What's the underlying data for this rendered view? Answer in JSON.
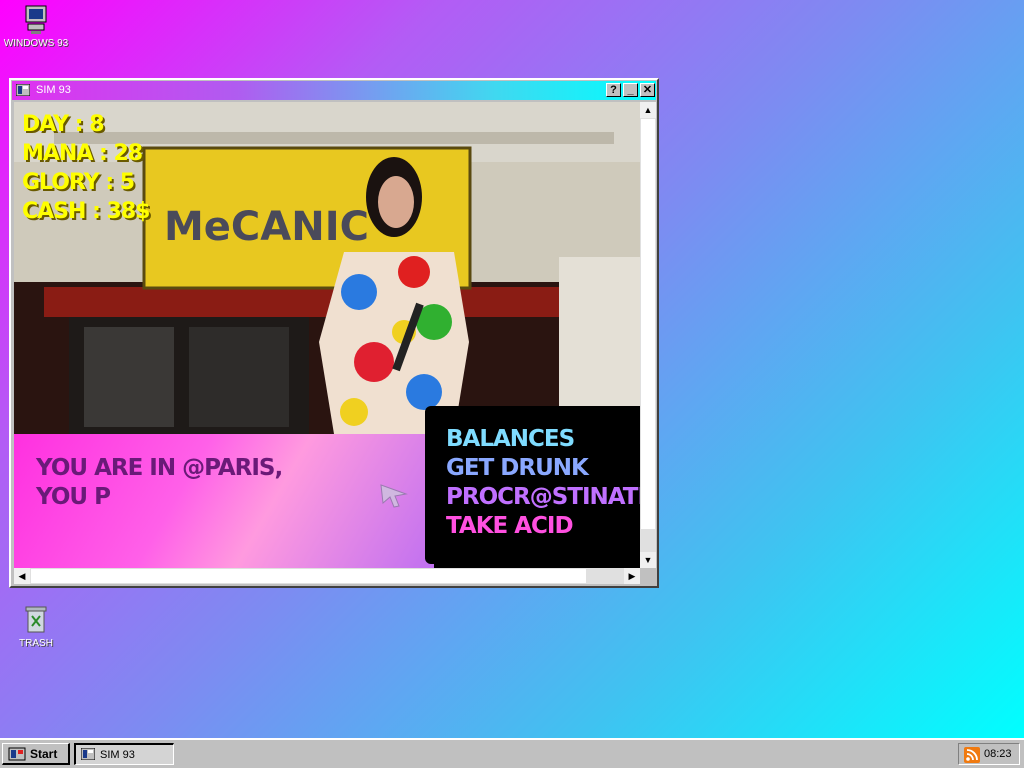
{
  "desktop": {
    "icons": [
      {
        "label": "WINDOWS 93",
        "icon": "computer-icon"
      },
      {
        "label": "TRASH",
        "icon": "trash-icon"
      }
    ]
  },
  "window": {
    "title": "SIM 93",
    "help_label": "?",
    "minimize_label": "_",
    "close_label": "✕"
  },
  "game": {
    "stats": [
      {
        "label": "DAY : 8"
      },
      {
        "label": "MANA : 28"
      },
      {
        "label": "GLORY : 5"
      },
      {
        "label": "CASH : 38$"
      }
    ],
    "dialog_text": "YOU ARE IN @PARIS, YOU P",
    "menu": [
      {
        "label": "BALANCES",
        "color": "#7fdcff"
      },
      {
        "label": "GET DRUNK",
        "color": "#8aa8ff"
      },
      {
        "label": "PROCR@STINATION",
        "color": "#c070ff"
      },
      {
        "label": "TAKE ACID",
        "color": "#ff50e0"
      }
    ],
    "storefront_sign": "MeCANIC"
  },
  "taskbar": {
    "start_label": "Start",
    "tasks": [
      {
        "label": "SIM 93"
      }
    ],
    "clock": "08:23"
  }
}
